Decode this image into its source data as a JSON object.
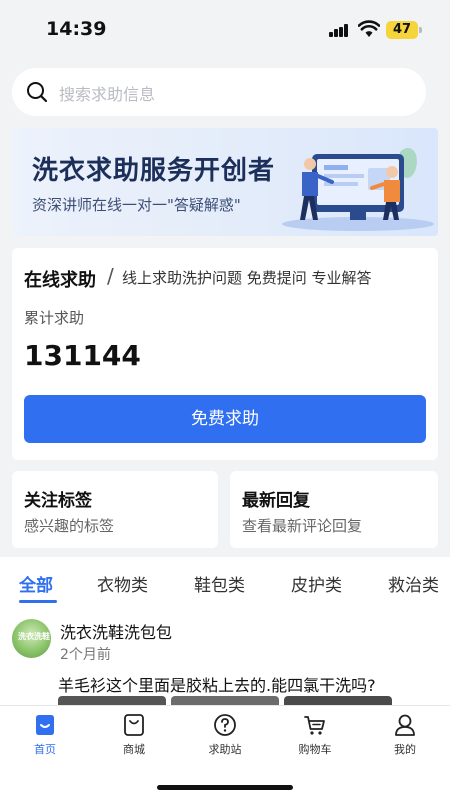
{
  "status_bar": {
    "time": "14:39",
    "battery": "47"
  },
  "search": {
    "placeholder": "搜索求助信息"
  },
  "banner": {
    "title": "洗衣求助服务开创者",
    "subtitle": "资深讲师在线一对一\"答疑解惑\""
  },
  "help_card": {
    "title": "在线求助",
    "separator": "/",
    "description": "线上求助洗护问题 免费提问 专业解答",
    "total_label": "累计求助",
    "total_count": "131144",
    "button_label": "免费求助"
  },
  "tiles": [
    {
      "title": "关注标签",
      "subtitle": "感兴趣的标签"
    },
    {
      "title": "最新回复",
      "subtitle": "查看最新评论回复"
    }
  ],
  "category_tabs": [
    "全部",
    "衣物类",
    "鞋包类",
    "皮护类",
    "救治类"
  ],
  "active_category": "全部",
  "post": {
    "avatar_text": "洗衣洗鞋",
    "author": "洗衣洗鞋洗包包",
    "time": "2个月前",
    "text": "羊毛衫这个里面是胶粘上去的.能四氯干洗吗?"
  },
  "tab_bar": [
    {
      "label": "首页",
      "icon": "home-icon"
    },
    {
      "label": "商城",
      "icon": "shopping-bag-icon"
    },
    {
      "label": "求助站",
      "icon": "question-icon"
    },
    {
      "label": "购物车",
      "icon": "cart-icon"
    },
    {
      "label": "我的",
      "icon": "user-icon"
    }
  ],
  "colors": {
    "accent": "#2f6ff0",
    "battery": "#f5d43c"
  }
}
